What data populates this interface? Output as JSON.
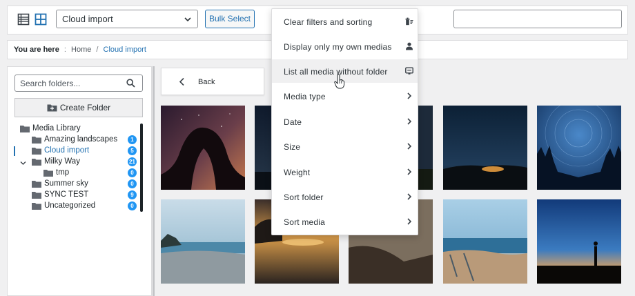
{
  "toolbar": {
    "folder_select_value": "Cloud import",
    "bulk_select_label": "Bulk Select",
    "search_value": ""
  },
  "breadcrumb": {
    "prefix": "You are here",
    "separator_1": ":",
    "home": "Home",
    "separator_2": "/",
    "current": "Cloud import"
  },
  "sidebar": {
    "search_placeholder": "Search folders...",
    "create_folder_label": "Create Folder",
    "tree": [
      {
        "label": "Media Library",
        "count": ""
      },
      {
        "label": "Amazing landscapes",
        "count": "1"
      },
      {
        "label": "Cloud import",
        "count": "5"
      },
      {
        "label": "Milky Way",
        "count": "21"
      },
      {
        "label": "tmp",
        "count": "0"
      },
      {
        "label": "Summer sky",
        "count": "0"
      },
      {
        "label": "SYNC TEST",
        "count": "9"
      },
      {
        "label": "Uncategorized",
        "count": "0"
      }
    ]
  },
  "main": {
    "back_label": "Back"
  },
  "menu": {
    "items": [
      {
        "label": "Clear filters and sorting",
        "icon": "trash-filter-icon"
      },
      {
        "label": "Display only my own medias",
        "icon": "user-icon"
      },
      {
        "label": "List all media without folder",
        "icon": "screen-icon"
      },
      {
        "label": "Media type",
        "icon": "chevron-right-icon"
      },
      {
        "label": "Date",
        "icon": "chevron-right-icon"
      },
      {
        "label": "Size",
        "icon": "chevron-right-icon"
      },
      {
        "label": "Weight",
        "icon": "chevron-right-icon"
      },
      {
        "label": "Sort folder",
        "icon": "chevron-right-icon"
      },
      {
        "label": "Sort media",
        "icon": "chevron-right-icon"
      }
    ]
  },
  "colors": {
    "accent": "#2271b1",
    "badge": "#2196f3",
    "page_bg": "#f0f0f1"
  }
}
